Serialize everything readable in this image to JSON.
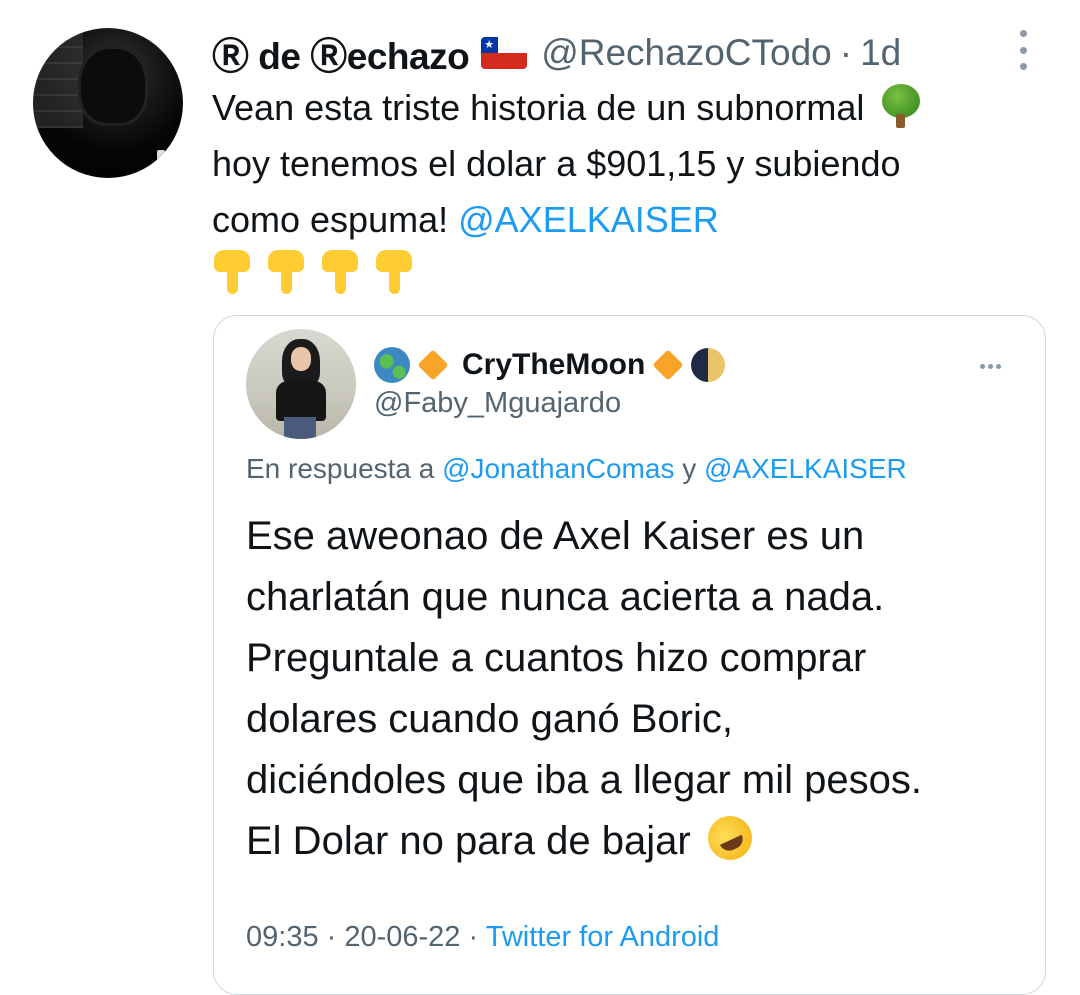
{
  "tweet": {
    "display_name": "Ⓡ de Ⓡechazo",
    "flag_icon": "chile-flag-icon",
    "handle": "@RechazoCTodo",
    "separator": "·",
    "time": "1d",
    "text_line1": "Vean esta triste historia de un subnormal",
    "text_line2": "hoy tenemos el dolar a $901,15 y subiendo",
    "text_line3_prefix": "como espuma!",
    "mention": "@AXELKAISER",
    "emoji_tree": "deciduous-tree-emoji",
    "emoji_pointing": [
      "backhand-index-pointing-down-emoji",
      "backhand-index-pointing-down-emoji",
      "backhand-index-pointing-down-emoji",
      "backhand-index-pointing-down-emoji"
    ]
  },
  "quoted": {
    "display_name": "CryTheMoon",
    "name_emojis": [
      "globe-americas-emoji",
      "orange-diamond-emoji",
      "orange-diamond-emoji",
      "last-quarter-moon-emoji"
    ],
    "handle": "@Faby_Mguajardo",
    "reply_prefix": "En respuesta a",
    "reply_mention_1": "@JonathanComas",
    "reply_and": "y",
    "reply_mention_2": "@AXELKAISER",
    "body_lines": [
      "Ese aweonao de Axel Kaiser es un",
      "charlatán que nunca acierta a nada.",
      "Preguntale a cuantos hizo comprar",
      "dolares cuando ganó Boric,",
      "diciéndoles que iba a llegar mil pesos.",
      "El Dolar no para de bajar"
    ],
    "body_emoji": "rolling-on-floor-laughing-emoji",
    "timestamp": "09:35 · 20-06-22",
    "footer_separator": "·",
    "source": "Twitter for Android"
  },
  "colors": {
    "link": "#1d9bf0",
    "secondary_text": "#536471",
    "primary_text": "#0f1419",
    "border": "#cfd9de"
  }
}
